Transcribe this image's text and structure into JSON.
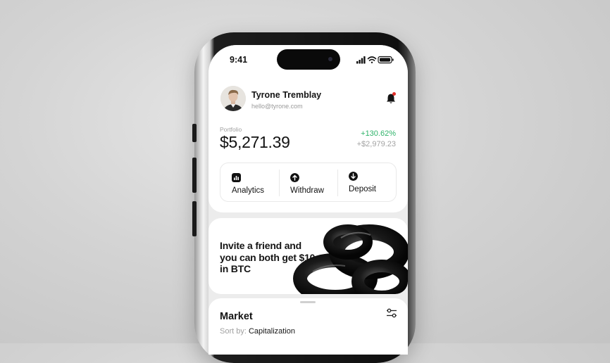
{
  "status_bar": {
    "time": "9:41"
  },
  "profile": {
    "name": "Tyrone Tremblay",
    "email": "hello@tyrone.com"
  },
  "portfolio": {
    "label": "Portfolio",
    "value": "$5,271.39",
    "change_pct": "+130.62%",
    "change_abs": "+$2,979.23"
  },
  "actions": [
    {
      "label": "Analytics",
      "icon": "bar-chart-icon"
    },
    {
      "label": "Withdraw",
      "icon": "arrow-up-icon"
    },
    {
      "label": "Deposit",
      "icon": "arrow-down-icon"
    }
  ],
  "promo": {
    "text": "Invite a friend and you can both get $10 in BTC"
  },
  "market": {
    "title": "Market",
    "sort_label": "Sort by:",
    "sort_value": "Capitalization"
  },
  "colors": {
    "positive": "#2fb36a",
    "notification": "#e0302a"
  }
}
